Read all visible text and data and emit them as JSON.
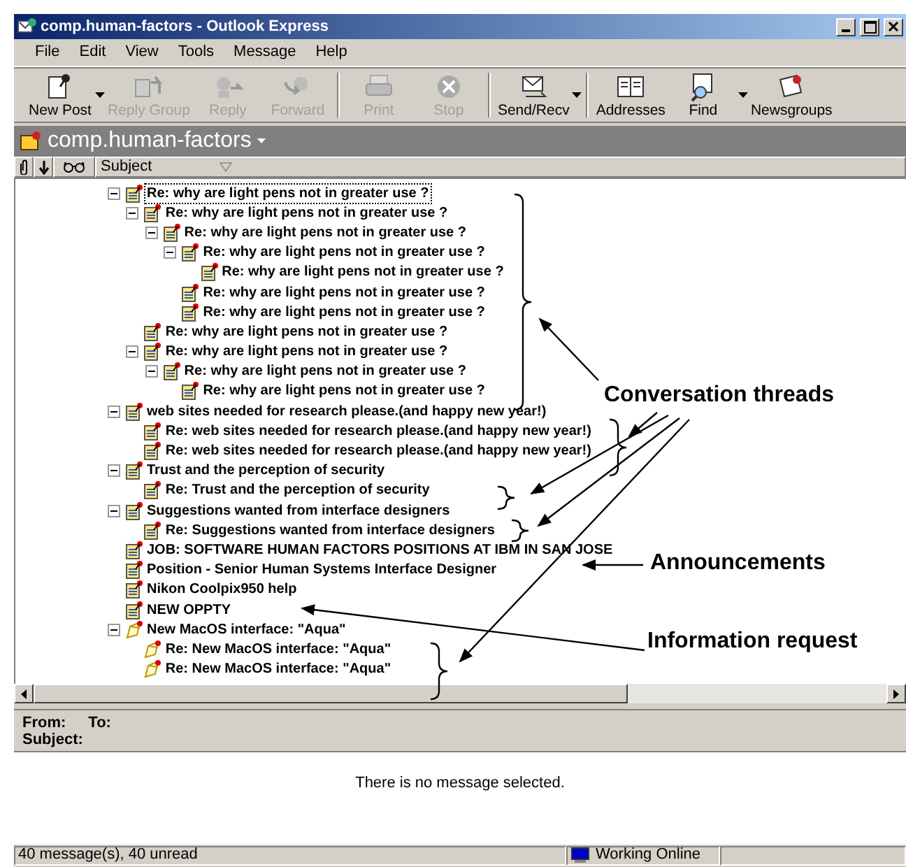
{
  "window": {
    "title": "comp.human-factors - Outlook Express"
  },
  "menu": [
    "File",
    "Edit",
    "View",
    "Tools",
    "Message",
    "Help"
  ],
  "toolbar": [
    {
      "kind": "new-post",
      "label": "New Post",
      "disabled": false,
      "dropdown": true
    },
    {
      "kind": "reply-group",
      "label": "Reply Group",
      "disabled": true
    },
    {
      "kind": "reply",
      "label": "Reply",
      "disabled": true
    },
    {
      "kind": "forward",
      "label": "Forward",
      "disabled": true,
      "separator_after": true
    },
    {
      "kind": "print",
      "label": "Print",
      "disabled": true
    },
    {
      "kind": "stop",
      "label": "Stop",
      "disabled": true,
      "separator_after": true
    },
    {
      "kind": "send-recv",
      "label": "Send/Recv",
      "disabled": false,
      "dropdown": true,
      "separator_after": true
    },
    {
      "kind": "addresses",
      "label": "Addresses",
      "disabled": false
    },
    {
      "kind": "find",
      "label": "Find",
      "disabled": false,
      "dropdown": true
    },
    {
      "kind": "newsgroups",
      "label": "Newsgroups",
      "disabled": false
    }
  ],
  "folder": {
    "name": "comp.human-factors"
  },
  "columns": {
    "subject": "Subject"
  },
  "messages": [
    {
      "kind": "article",
      "subject": "Re: why are light pens not in greater use ?",
      "selected": true,
      "expanded": true,
      "children": [
        {
          "kind": "article",
          "subject": "Re: why are light pens not in greater use ?",
          "selected": false,
          "expanded": true,
          "children": [
            {
              "kind": "article",
              "subject": "Re: why are light pens not in greater use ?",
              "selected": false,
              "expanded": true,
              "children": [
                {
                  "kind": "article",
                  "subject": "Re: why are light pens not in greater use ?",
                  "selected": false,
                  "expanded": true,
                  "children": [
                    {
                      "kind": "article",
                      "subject": "Re: why are light pens not in greater use ?",
                      "selected": false
                    }
                  ]
                },
                {
                  "kind": "article",
                  "subject": "Re: why are light pens not in greater use ?",
                  "selected": false
                },
                {
                  "kind": "article",
                  "subject": "Re: why are light pens not in greater use ?",
                  "selected": false
                }
              ]
            }
          ]
        },
        {
          "kind": "article",
          "subject": "Re: why are light pens not in greater use ?",
          "selected": false
        },
        {
          "kind": "article",
          "subject": "Re: why are light pens not in greater use ?",
          "selected": false,
          "expanded": true,
          "children": [
            {
              "kind": "article",
              "subject": "Re: why are light pens not in greater use ?",
              "selected": false,
              "expanded": true,
              "children": [
                {
                  "kind": "article",
                  "subject": "Re: why are light pens not in greater use ?",
                  "selected": false
                }
              ]
            }
          ]
        }
      ]
    },
    {
      "kind": "article",
      "subject": "web sites needed for research please.(and happy new year!)",
      "selected": false,
      "expanded": true,
      "children": [
        {
          "kind": "article",
          "subject": "Re: web sites needed for research please.(and happy new year!)",
          "selected": false
        },
        {
          "kind": "article",
          "subject": "Re: web sites needed for research please.(and happy new year!)",
          "selected": false
        }
      ]
    },
    {
      "kind": "article",
      "subject": "Trust and the perception of security",
      "selected": false,
      "expanded": true,
      "children": [
        {
          "kind": "article",
          "subject": "Re: Trust and the perception of security",
          "selected": false
        }
      ]
    },
    {
      "kind": "article",
      "subject": "Suggestions wanted from interface designers",
      "selected": false,
      "expanded": true,
      "children": [
        {
          "kind": "article",
          "subject": "Re: Suggestions wanted from interface designers",
          "selected": false
        }
      ]
    },
    {
      "kind": "article",
      "subject": "JOB: SOFTWARE HUMAN FACTORS POSITIONS AT IBM IN SAN JOSE",
      "selected": false
    },
    {
      "kind": "article",
      "subject": "Position - Senior Human Systems Interface Designer",
      "selected": false
    },
    {
      "kind": "article",
      "subject": "Nikon Coolpix950 help",
      "selected": false
    },
    {
      "kind": "article",
      "subject": "NEW OPPTY",
      "selected": false
    },
    {
      "kind": "draft",
      "subject": "New MacOS interface: \"Aqua\"",
      "selected": false,
      "expanded": true,
      "children": [
        {
          "kind": "draft",
          "subject": "Re: New MacOS interface: \"Aqua\"",
          "selected": false
        },
        {
          "kind": "draft",
          "subject": "Re: New MacOS interface: \"Aqua\"",
          "selected": false
        }
      ]
    }
  ],
  "preview": {
    "from_label": "From:",
    "to_label": "To:",
    "subject_label": "Subject:",
    "body": "There is no message selected."
  },
  "status_bar": {
    "count": "40 message(s), 40 unread",
    "connection": "Working Online"
  },
  "annotations": [
    {
      "text": "Conversation threads"
    },
    {
      "text": "Announcements"
    },
    {
      "text": "Information request"
    }
  ]
}
